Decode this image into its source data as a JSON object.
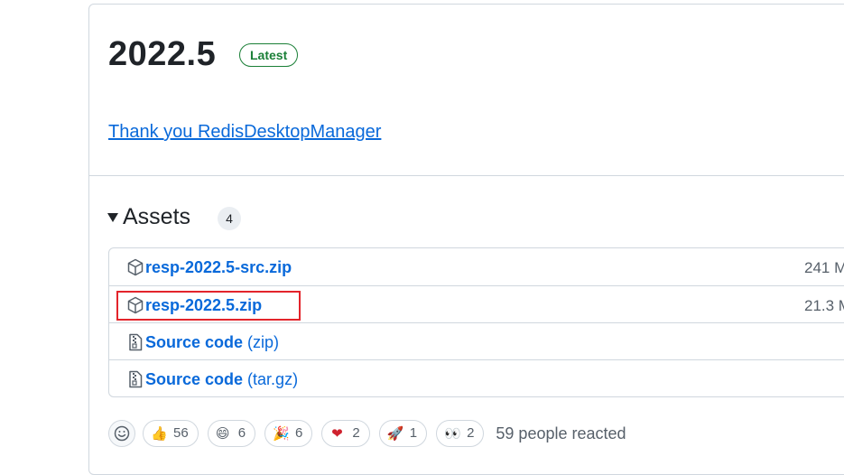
{
  "release": {
    "title": "2022.5",
    "badge": "Latest",
    "body_link": "Thank you RedisDesktopManager"
  },
  "assets": {
    "title": "Assets",
    "count": "4",
    "items": [
      {
        "name": "resp-2022.5-src.zip",
        "suffix": "",
        "size": "241 M",
        "icon": "package-icon"
      },
      {
        "name": "resp-2022.5.zip",
        "suffix": "",
        "size": "21.3 M",
        "icon": "package-icon",
        "highlighted": true
      },
      {
        "name": "Source code",
        "suffix": "(zip)",
        "size": "",
        "icon": "file-zip-icon"
      },
      {
        "name": "Source code",
        "suffix": "(tar.gz)",
        "size": "",
        "icon": "file-zip-icon"
      }
    ]
  },
  "reactions": {
    "items": [
      {
        "emoji": "👍",
        "name": "thumbs-up",
        "count": "56"
      },
      {
        "emoji": "😄",
        "name": "laugh",
        "count": "6"
      },
      {
        "emoji": "🎉",
        "name": "hooray",
        "count": "6"
      },
      {
        "emoji": "❤",
        "name": "heart",
        "count": "2"
      },
      {
        "emoji": "🚀",
        "name": "rocket",
        "count": "1"
      },
      {
        "emoji": "👀",
        "name": "eyes",
        "count": "2"
      }
    ],
    "summary": "59 people reacted"
  },
  "colors": {
    "link": "#0969da",
    "badge_green": "#1a7f37",
    "highlight_red": "#e3242b",
    "border": "#d0d7de"
  }
}
